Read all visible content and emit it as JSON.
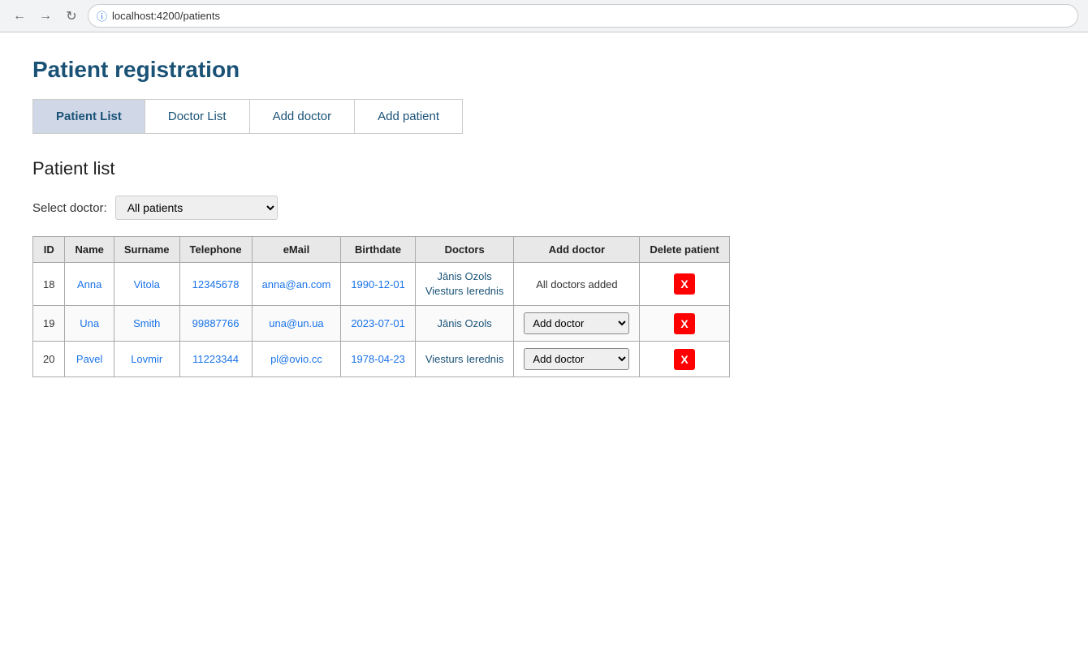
{
  "browser": {
    "url": "localhost:4200/patients"
  },
  "page": {
    "title": "Patient registration"
  },
  "tabs": [
    {
      "id": "patient-list",
      "label": "Patient List",
      "active": true
    },
    {
      "id": "doctor-list",
      "label": "Doctor List",
      "active": false
    },
    {
      "id": "add-doctor",
      "label": "Add doctor",
      "active": false
    },
    {
      "id": "add-patient",
      "label": "Add patient",
      "active": false
    }
  ],
  "section_title": "Patient list",
  "select_doctor_label": "Select doctor:",
  "doctor_options": [
    {
      "value": "all",
      "label": "All patients"
    },
    {
      "value": "janis",
      "label": "Jānis Ozols"
    },
    {
      "value": "viesturs",
      "label": "Viesturs Ierednis"
    }
  ],
  "selected_doctor": "All patients",
  "table": {
    "headers": [
      "ID",
      "Name",
      "Surname",
      "Telephone",
      "eMail",
      "Birthdate",
      "Doctors",
      "Add doctor",
      "Delete patient"
    ],
    "rows": [
      {
        "id": 18,
        "name": "Anna",
        "surname": "Vitola",
        "telephone": "12345678",
        "email": "anna@an.com",
        "birthdate": "1990-12-01",
        "doctors": "Jānis Ozols\nViesturs Ierednis",
        "add_doctor_status": "text",
        "add_doctor_text": "All doctors added",
        "delete_label": "X"
      },
      {
        "id": 19,
        "name": "Una",
        "surname": "Smith",
        "telephone": "99887766",
        "email": "una@un.ua",
        "birthdate": "2023-07-01",
        "doctors": "Jānis Ozols",
        "add_doctor_status": "dropdown",
        "add_doctor_text": "Add doctor",
        "delete_label": "X"
      },
      {
        "id": 20,
        "name": "Pavel",
        "surname": "Lovmir",
        "telephone": "11223344",
        "email": "pl@ovio.cc",
        "birthdate": "1978-04-23",
        "doctors": "Viesturs Ierednis",
        "add_doctor_status": "dropdown",
        "add_doctor_text": "Add doctor",
        "delete_label": "X"
      }
    ]
  },
  "icons": {
    "back": "←",
    "forward": "→",
    "refresh": "↻",
    "info": "ⓘ",
    "dropdown_arrow": "▾",
    "delete": "X"
  }
}
